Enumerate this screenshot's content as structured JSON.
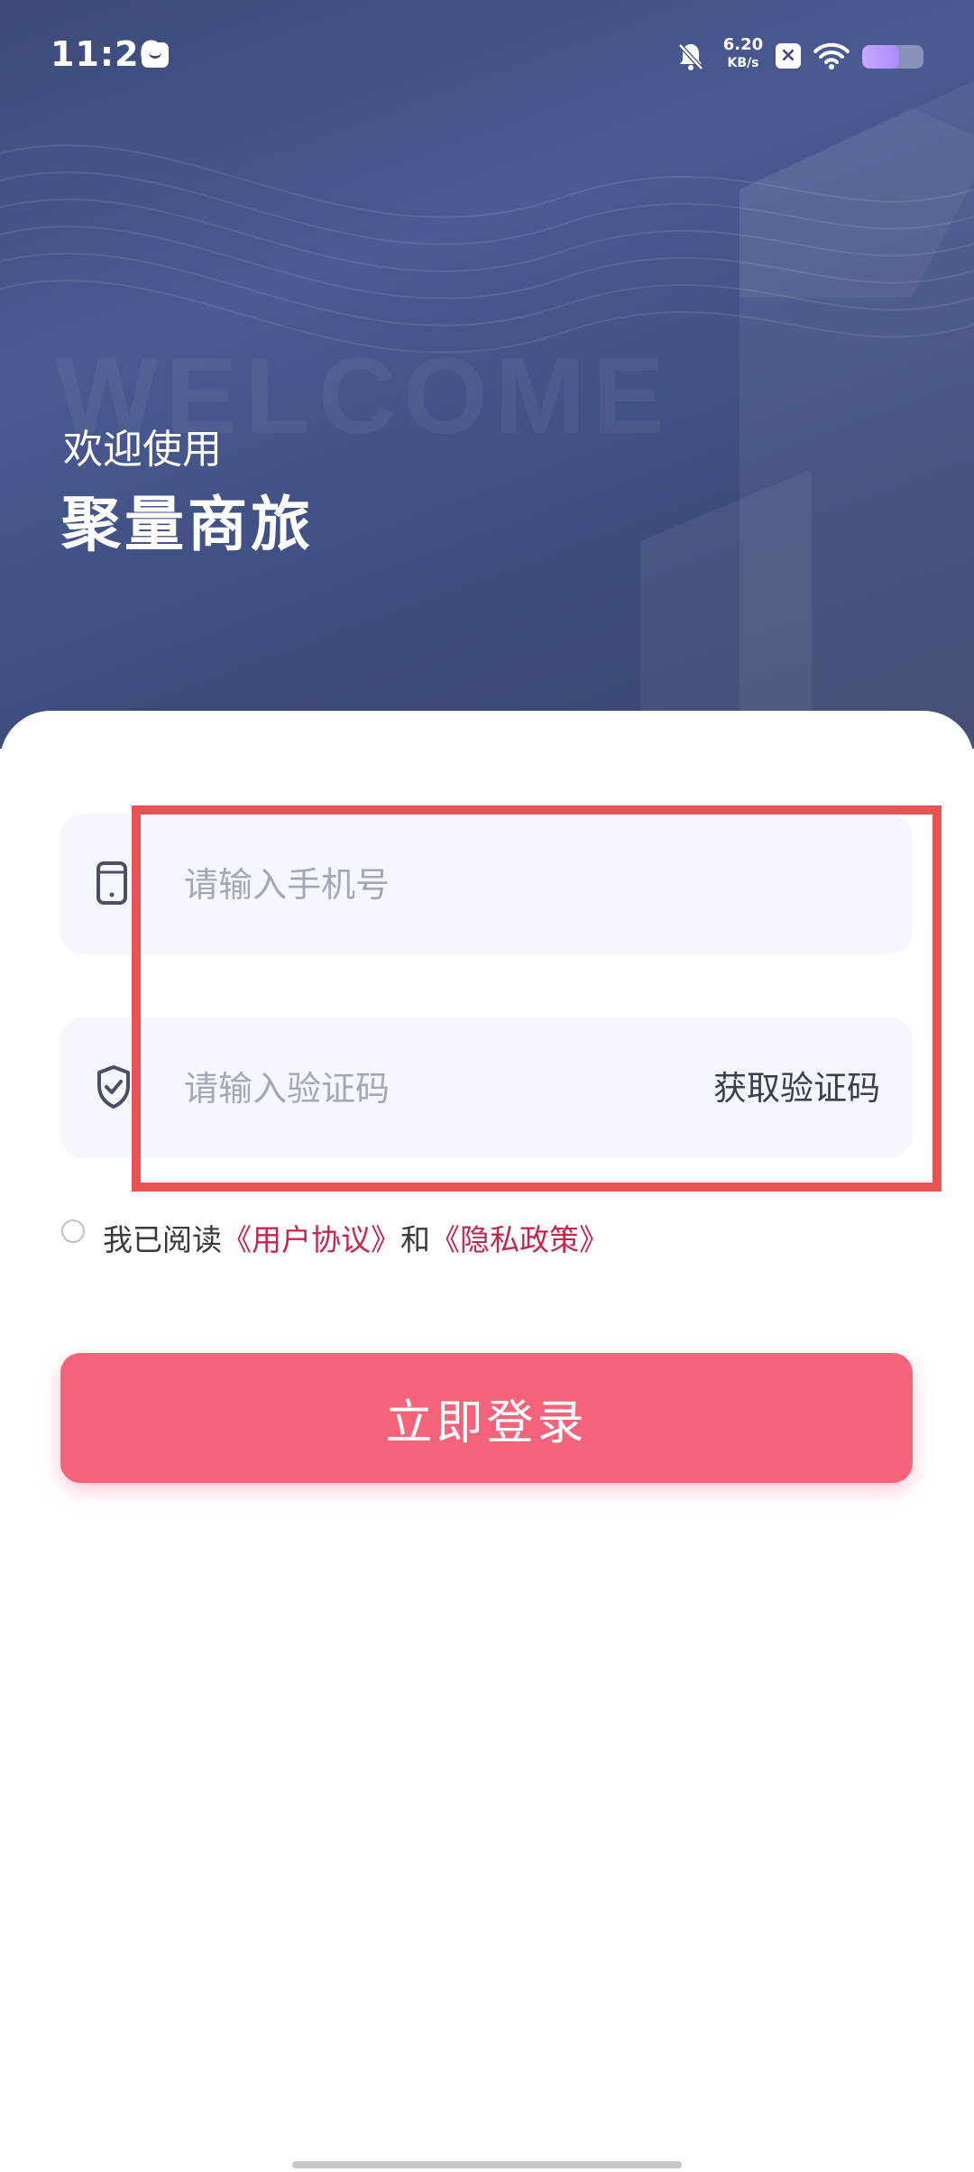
{
  "status_bar": {
    "time": "11:20",
    "net_speed_value": "6.20",
    "net_speed_unit": "KB/s",
    "x_badge": "×",
    "battery_level_fraction": 0.6
  },
  "hero": {
    "watermark": "WELCOME",
    "welcome_line": "欢迎使用",
    "app_name": "聚量商旅"
  },
  "login_form": {
    "phone_placeholder": "请输入手机号",
    "code_placeholder": "请输入验证码",
    "get_code_label": "获取验证码"
  },
  "agreement": {
    "prefix": "我已阅读",
    "user_agreement": "《用户协议》",
    "conjunction": "和",
    "privacy_policy": "《隐私政策》"
  },
  "login_button_label": "立即登录",
  "colors": {
    "hero_bg": "#3e4b79",
    "accent": "#f5637b",
    "link": "#c72550",
    "highlight": "#eb5253"
  },
  "icons": {
    "phone_field": "phone-icon",
    "code_field": "shield-check-icon",
    "status_mute": "bell-off-icon",
    "status_wifi": "wifi-icon",
    "status_battery": "battery-icon"
  }
}
